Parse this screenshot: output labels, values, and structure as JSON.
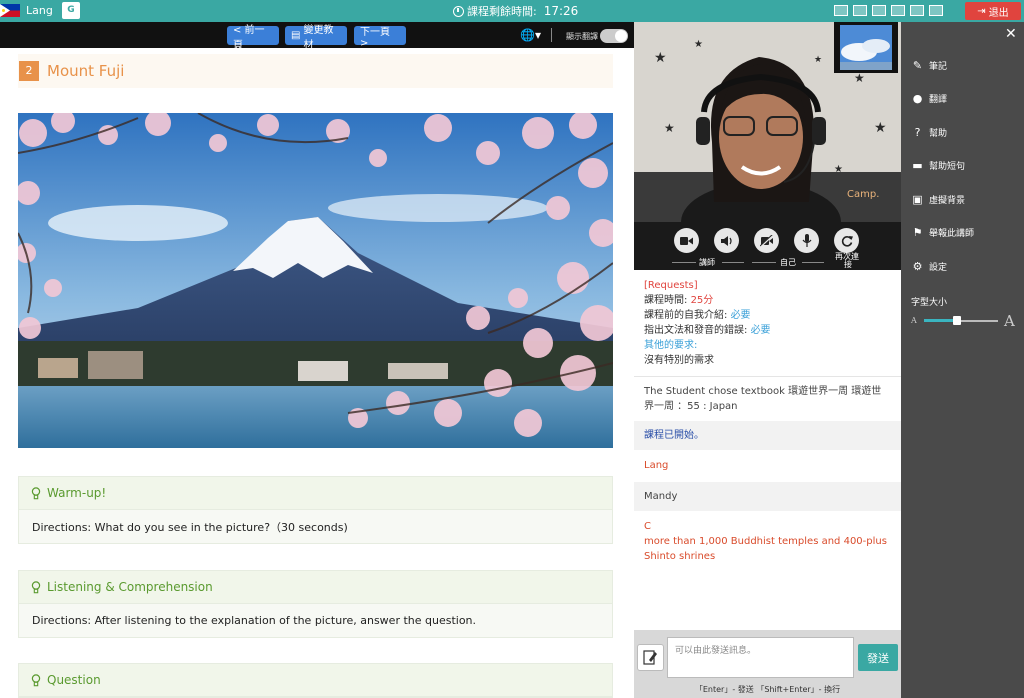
{
  "topbar": {
    "username": "Lang",
    "translate_icon_text": "G",
    "timer_label": "課程剩餘時間:",
    "timer_value": "17:26",
    "exit_label": "退出"
  },
  "lesson_toolbar": {
    "prev_label": "< 前一頁",
    "change_label": "變更教材",
    "next_label": "下一頁 >",
    "translate_toggle_label": "顯示翻譯"
  },
  "lesson": {
    "number": "2",
    "title": "Mount Fuji",
    "sections": [
      {
        "title": "Warm-up!",
        "directions": "Directions: What do you see in the picture?（30 seconds)"
      },
      {
        "title": "Listening & Comprehension",
        "directions": "Directions: After listening to the explanation of the picture, answer the question."
      },
      {
        "title": "Question",
        "directions": ""
      }
    ]
  },
  "video": {
    "watermark": "Camp.",
    "controls": {
      "teacher_label": "講師",
      "self_label": "自己",
      "reconnect_label_1": "再次連",
      "reconnect_label_2": "接"
    }
  },
  "chat": {
    "requests_title": "[Requests]",
    "duration_label": "課程時間: ",
    "duration_value": "25分",
    "intro_label": "課程前的自我介紹: ",
    "intro_value": "必要",
    "correct_label": "指出文法和發音的錯誤: ",
    "correct_value": "必要",
    "other_label": "其他的要求:",
    "other_value": "沒有特別的需求",
    "textbook_msg": "The Student chose textbook 環遊世界一周  環遊世界一周 ：55 : Japan",
    "system_msg": "課程已開始。",
    "sender_lang": "Lang",
    "sender_mandy": "Mandy",
    "msg_c_line1": "C",
    "msg_c_line2": "more than 1,000 Buddhist temples and 400-plus Shinto shrines",
    "input_placeholder": "可以由此發送訊息。",
    "send_label": "發送",
    "hint": "「Enter」- 發送   「Shift+Enter」- 換行"
  },
  "sidebar": {
    "items": [
      {
        "label": "筆記",
        "icon": "edit-icon"
      },
      {
        "label": "翻譯",
        "icon": "globe-icon"
      },
      {
        "label": "幫助",
        "icon": "question-icon"
      },
      {
        "label": "幫助短句",
        "icon": "chat-bubble-icon"
      },
      {
        "label": "虛擬背景",
        "icon": "image-icon"
      },
      {
        "label": "舉報此講師",
        "icon": "flag-icon"
      },
      {
        "label": "設定",
        "icon": "gear-icon"
      }
    ],
    "font_size_label": "字型大小",
    "font_small": "A",
    "font_large": "A",
    "font_size_level": 0.45
  },
  "colors": {
    "topbar": "#3aa8a3",
    "exit": "#e0443e",
    "nav_button": "#3b7fd8",
    "accent_orange": "#e8924a",
    "section_green": "#5a9a2f"
  }
}
